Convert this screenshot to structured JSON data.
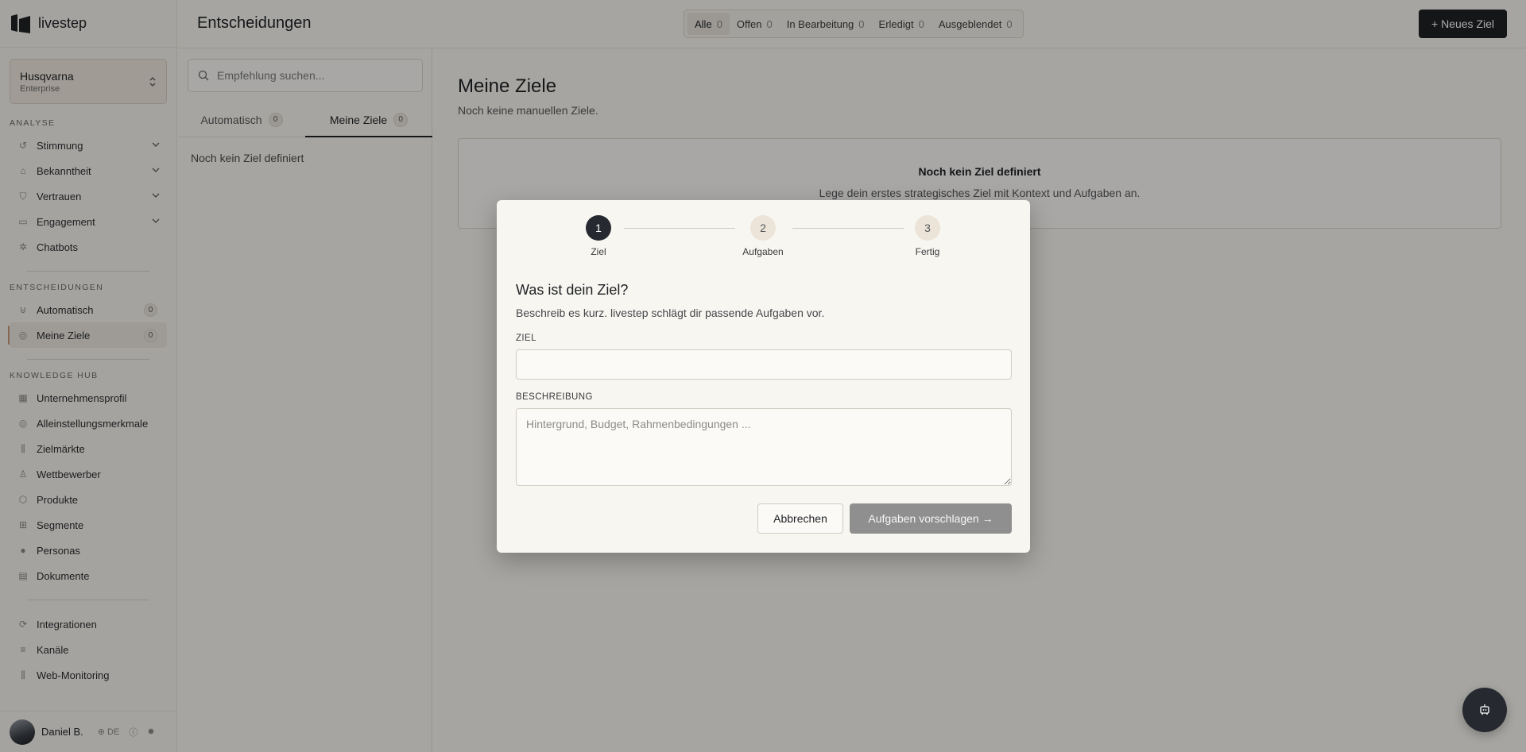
{
  "app": {
    "brand": "livestep"
  },
  "org": {
    "name": "Husqvarna",
    "plan": "Enterprise"
  },
  "sidebar": {
    "analyse_label": "ANALYSE",
    "analyse": [
      {
        "label": "Stimmung",
        "icon": "sentiment-icon"
      },
      {
        "label": "Bekanntheit",
        "icon": "awareness-icon"
      },
      {
        "label": "Vertrauen",
        "icon": "shield-check-icon"
      },
      {
        "label": "Engagement",
        "icon": "chat-icon"
      },
      {
        "label": "Chatbots",
        "icon": "bot-icon"
      }
    ],
    "entscheidungen_label": "ENTSCHEIDUNGEN",
    "entscheidungen": [
      {
        "label": "Automatisch",
        "count": "0",
        "icon": "magnet-icon"
      },
      {
        "label": "Meine Ziele",
        "count": "0",
        "icon": "target-icon"
      }
    ],
    "knowledge_label": "KNOWLEDGE HUB",
    "knowledge": [
      {
        "label": "Unternehmensprofil",
        "icon": "building-icon"
      },
      {
        "label": "Alleinstellungsmerkmale",
        "icon": "target-icon"
      },
      {
        "label": "Zielmärkte",
        "icon": "bars-icon"
      },
      {
        "label": "Wettbewerber",
        "icon": "user-icon"
      },
      {
        "label": "Produkte",
        "icon": "box-icon"
      },
      {
        "label": "Segmente",
        "icon": "grid-icon"
      },
      {
        "label": "Personas",
        "icon": "person-icon"
      },
      {
        "label": "Dokumente",
        "icon": "file-icon"
      }
    ],
    "tools": [
      {
        "label": "Integrationen",
        "icon": "refresh-icon"
      },
      {
        "label": "Kanäle",
        "icon": "menu-icon"
      },
      {
        "label": "Web-Monitoring",
        "icon": "signal-icon"
      }
    ]
  },
  "user": {
    "name": "Daniel B.",
    "language": "DE"
  },
  "topbar": {
    "title": "Entscheidungen",
    "filters": [
      {
        "label": "Alle",
        "count": "0"
      },
      {
        "label": "Offen",
        "count": "0"
      },
      {
        "label": "In Bearbeitung",
        "count": "0"
      },
      {
        "label": "Erledigt",
        "count": "0"
      },
      {
        "label": "Ausgeblendet",
        "count": "0"
      }
    ],
    "new_goal_label": "+ Neues Ziel"
  },
  "listpanel": {
    "search_placeholder": "Empfehlung suchen...",
    "tabs": [
      {
        "label": "Automatisch",
        "count": "0"
      },
      {
        "label": "Meine Ziele",
        "count": "0"
      }
    ],
    "empty_text": "Noch kein Ziel definiert"
  },
  "main": {
    "title": "Meine Ziele",
    "subtitle": "Noch keine manuellen Ziele.",
    "empty_title": "Noch kein Ziel definiert",
    "empty_text": "Lege dein erstes strategisches Ziel mit Kontext und Aufgaben an."
  },
  "modal": {
    "steps": [
      {
        "number": "1",
        "label": "Ziel"
      },
      {
        "number": "2",
        "label": "Aufgaben"
      },
      {
        "number": "3",
        "label": "Fertig"
      }
    ],
    "title": "Was ist dein Ziel?",
    "subtitle": "Beschreib es kurz. livestep schlägt dir passende Aufgaben vor.",
    "ziel_label": "ZIEL",
    "ziel_value": "",
    "beschreibung_label": "BESCHREIBUNG",
    "beschreibung_placeholder": "Hintergrund, Budget, Rahmenbedingungen ...",
    "cancel_label": "Abbrechen",
    "submit_label": "Aufgaben vorschlagen →"
  },
  "colors": {
    "accent": "#1f2124",
    "active_indicator": "#c79c78",
    "disabled_button": "#8f8f8f"
  }
}
